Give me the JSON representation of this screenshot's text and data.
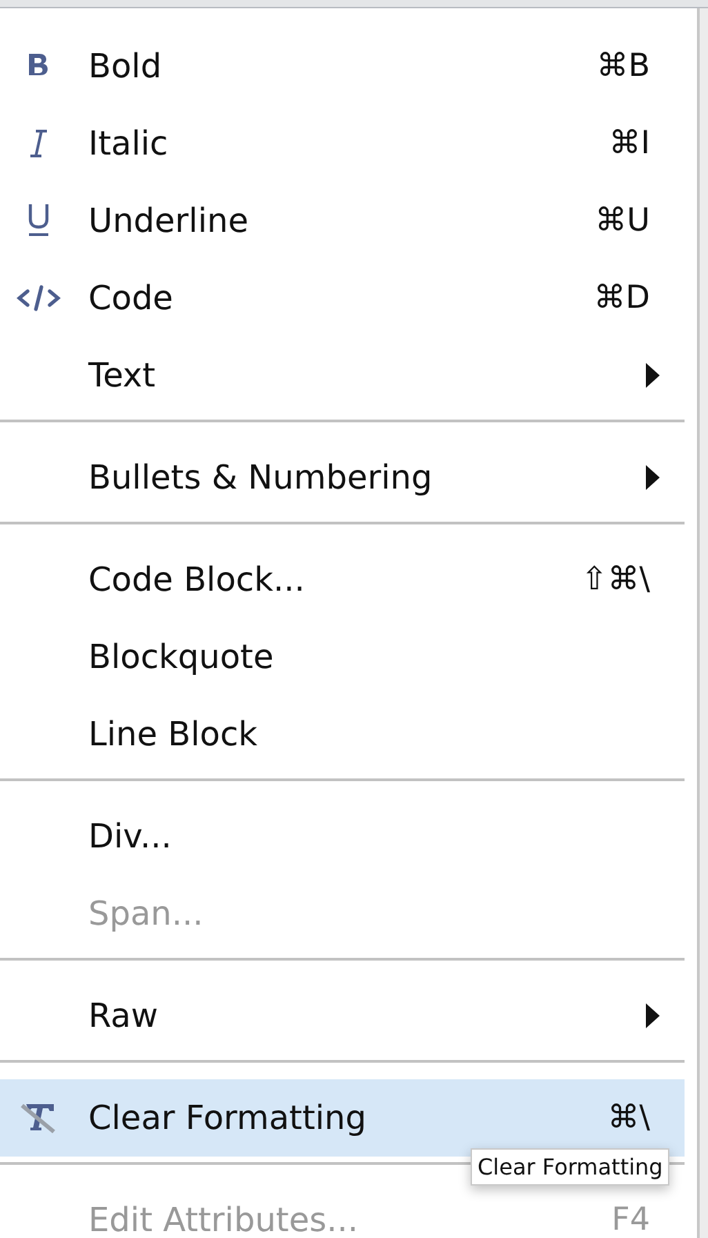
{
  "menu": {
    "items": [
      {
        "kind": "item",
        "label": "Bold",
        "shortcut": "⌘B",
        "submenu": false,
        "disabled": false,
        "selected": false
      },
      {
        "kind": "item",
        "label": "Italic",
        "shortcut": "⌘I",
        "submenu": false,
        "disabled": false,
        "selected": false
      },
      {
        "kind": "item",
        "label": "Underline",
        "shortcut": "⌘U",
        "submenu": false,
        "disabled": false,
        "selected": false
      },
      {
        "kind": "item",
        "label": "Code",
        "shortcut": "⌘D",
        "submenu": false,
        "disabled": false,
        "selected": false
      },
      {
        "kind": "item",
        "label": "Text",
        "submenu": true,
        "disabled": false,
        "selected": false
      },
      {
        "kind": "separator"
      },
      {
        "kind": "item",
        "label": "Bullets & Numbering",
        "submenu": true,
        "disabled": false,
        "selected": false
      },
      {
        "kind": "separator"
      },
      {
        "kind": "item",
        "label": "Code Block...",
        "shortcut": "⇧⌘\\",
        "submenu": false,
        "disabled": false,
        "selected": false
      },
      {
        "kind": "item",
        "label": "Blockquote",
        "submenu": false,
        "disabled": false,
        "selected": false
      },
      {
        "kind": "item",
        "label": "Line Block",
        "submenu": false,
        "disabled": false,
        "selected": false
      },
      {
        "kind": "separator"
      },
      {
        "kind": "item",
        "label": "Div...",
        "submenu": false,
        "disabled": false,
        "selected": false
      },
      {
        "kind": "item",
        "label": "Span...",
        "submenu": false,
        "disabled": true,
        "selected": false
      },
      {
        "kind": "separator"
      },
      {
        "kind": "item",
        "label": "Raw",
        "submenu": true,
        "disabled": false,
        "selected": false
      },
      {
        "kind": "separator"
      },
      {
        "kind": "item",
        "label": "Clear Formatting",
        "shortcut": "⌘\\",
        "submenu": false,
        "disabled": false,
        "selected": true
      },
      {
        "kind": "separator"
      },
      {
        "kind": "item",
        "label": "Edit Attributes...",
        "shortcut": "F4",
        "submenu": false,
        "disabled": true,
        "selected": false
      }
    ]
  },
  "tooltip": {
    "text": "Clear Formatting"
  }
}
